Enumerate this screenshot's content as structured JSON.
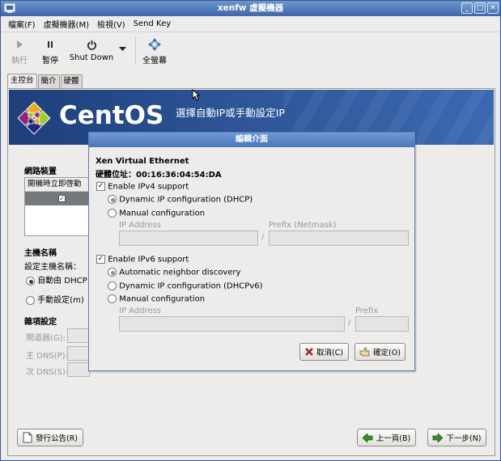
{
  "window": {
    "title": "xenfw 虛擬機器",
    "controls": [
      "_",
      "□",
      "✕"
    ]
  },
  "menu": [
    "檔案(F)",
    "虛擬機器(M)",
    "檢視(V)",
    "Send Key"
  ],
  "toolbar": {
    "run": "執行",
    "pause": "暫停",
    "shutdown": "Shut Down",
    "fullscreen": "全螢幕"
  },
  "tabs": [
    "主控台",
    "簡介",
    "硬體"
  ],
  "banner": {
    "brand": "CentOS",
    "title": "選擇自動IP或手動設定IP"
  },
  "background": {
    "network_devices_label": "網路裝置",
    "devlist_header": "開機時立即啓動",
    "hostname_label": "主機名稱",
    "hostname_setting": "設定主機名稱：",
    "auto_dhcp": "自動由 DHCP",
    "manual": "手動設定(m)",
    "misc_label": "雜項設定",
    "gateway": "閘道器(G):",
    "primary_dns": "主 DNS(P):",
    "secondary_dns": "次 DNS(S):"
  },
  "buttons": {
    "release_notes": "發行公告(R)",
    "back": "上一頁(B)",
    "next": "下一步(N)"
  },
  "dialog": {
    "title": "編輯介面",
    "device_name": "Xen Virtual Ethernet",
    "hw_address": "硬體位址：00:16:36:04:54:DA",
    "ipv4": {
      "enable": "Enable IPv4 support",
      "dhcp": "Dynamic IP configuration (DHCP)",
      "manual": "Manual configuration",
      "ip_label": "IP Address",
      "prefix_label": "Prefix (Netmask)",
      "separator": "/"
    },
    "ipv6": {
      "enable": "Enable IPv6 support",
      "auto": "Automatic neighbor discovery",
      "dhcp": "Dynamic IP configuration (DHCPv6)",
      "manual": "Manual configuration",
      "ip_label": "IP Address",
      "prefix_label": "Prefix",
      "separator": "/"
    },
    "cancel": "取消(C)",
    "ok": "確定(O)"
  }
}
